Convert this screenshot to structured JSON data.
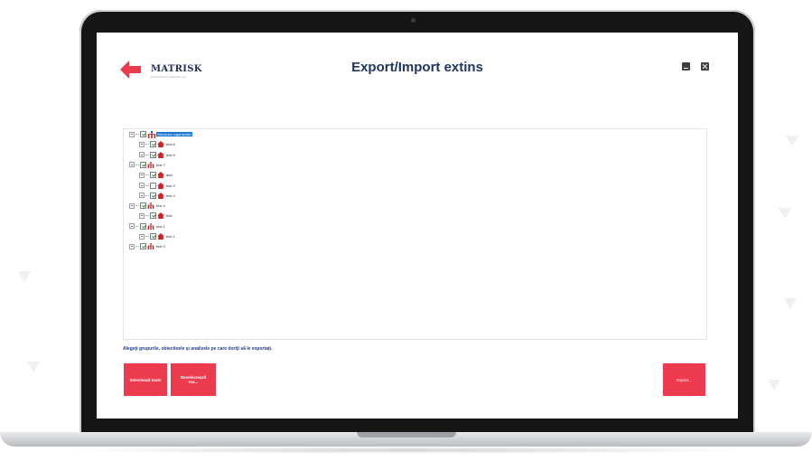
{
  "header": {
    "title": "Export/Import extins",
    "logo_text": "MATRISK",
    "logo_subtitle": "Performance in business, too"
  },
  "tree": {
    "items": [
      {
        "level": 0,
        "label": "Structura organizatiei",
        "checked": true,
        "icon": "organization-icon",
        "selected": true
      },
      {
        "level": 1,
        "label": "test 6",
        "checked": true,
        "icon": "home-icon"
      },
      {
        "level": 1,
        "label": "test 5",
        "checked": true,
        "icon": "home-icon"
      },
      {
        "level": 0,
        "label": "test 7",
        "checked": true,
        "icon": "org-chart-icon"
      },
      {
        "level": 1,
        "label": "add",
        "checked": true,
        "icon": "home-icon"
      },
      {
        "level": 1,
        "label": "test 3",
        "checked": false,
        "icon": "home-icon"
      },
      {
        "level": 1,
        "label": "test 4",
        "checked": true,
        "icon": "home-icon"
      },
      {
        "level": 0,
        "label": "test 4",
        "checked": true,
        "icon": "org-chart-icon"
      },
      {
        "level": 1,
        "label": "test",
        "checked": true,
        "icon": "home-icon"
      },
      {
        "level": 0,
        "label": "test 1",
        "checked": true,
        "icon": "org-chart-icon"
      },
      {
        "level": 1,
        "label": "test 1",
        "checked": true,
        "icon": "home-icon"
      },
      {
        "level": 0,
        "label": "test 3",
        "checked": true,
        "icon": "org-chart-icon"
      }
    ]
  },
  "instructions": "Alegeţi grupurile, obiectivele şi analizele pe care doriţi să le exportaţi.",
  "buttons": {
    "select_all": "Selectează toate",
    "deselect_all": "Deselectează toa...",
    "export": "Export..."
  },
  "colors": {
    "accent": "#ec3b4f",
    "title": "#1f3562",
    "selection": "#1976d2"
  }
}
